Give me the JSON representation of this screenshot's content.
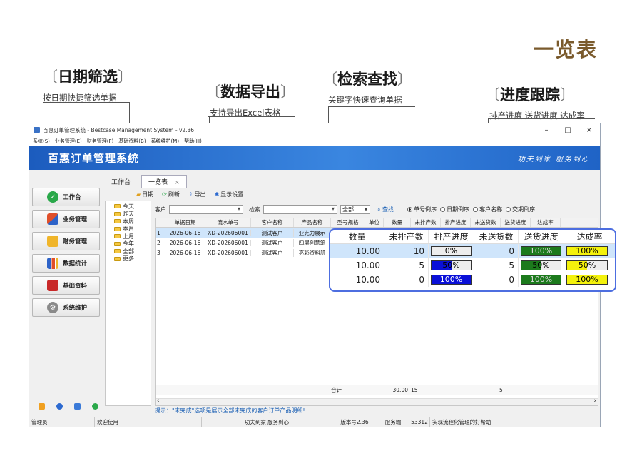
{
  "page_title": "一览表",
  "features": {
    "date_filter": {
      "title": "日期筛选",
      "desc": "按日期快捷筛选单据"
    },
    "data_export": {
      "title": "数据导出",
      "desc": "支持导出Excel表格"
    },
    "search": {
      "title": "检索查找",
      "desc": "关键字快速查询单据"
    },
    "progress": {
      "title": "进度跟踪",
      "desc": "排产进度 送货进度 达成率"
    }
  },
  "window": {
    "title": "百惠订单管理系统 - Bestcase Management System - v2.36",
    "controls": {
      "minimize": "–",
      "maximize": "□",
      "close": "×"
    },
    "menu": [
      "系统(S)",
      "业务管理(E)",
      "财务管理(F)",
      "基础资料(B)",
      "系统维护(M)",
      "帮助(H)"
    ],
    "banner_title": "百惠订单管理系统",
    "banner_slogan": "功夫到家 服务到心",
    "tabs": [
      {
        "label": "工作台"
      },
      {
        "label": "一览表",
        "close": "×"
      }
    ],
    "sidebar": [
      {
        "label": "工作台",
        "icon": "check-icon",
        "color": "#2aa84a"
      },
      {
        "label": "业务管理",
        "icon": "puzzle-icon",
        "color": "#e04f2a"
      },
      {
        "label": "财务管理",
        "icon": "folder-icon",
        "color": "#f0b52a"
      },
      {
        "label": "数据统计",
        "icon": "bar-chart-icon",
        "color": "#2d63c8"
      },
      {
        "label": "基础资料",
        "icon": "book-icon",
        "color": "#c82828"
      },
      {
        "label": "系统维护",
        "icon": "gear-icon",
        "color": "#8a8a8a"
      }
    ],
    "sidebar_bottom_icons": [
      {
        "icon": "note-icon",
        "color": "#f0a020"
      },
      {
        "icon": "info-icon",
        "color": "#2d6ad0"
      },
      {
        "icon": "calendar-icon",
        "color": "#3a7ad8"
      },
      {
        "icon": "refresh-icon",
        "color": "#2aa84a"
      }
    ],
    "toolbar": {
      "date": "日期",
      "refresh": "刷新",
      "export": "导出",
      "display_settings": "显示设置"
    },
    "tree": [
      "今天",
      "昨天",
      "本周",
      "本月",
      "上月",
      "今年",
      "全部",
      "更多.."
    ],
    "filter": {
      "customer_label": "客户",
      "search_label": "检索",
      "scope_value": "全部",
      "find_button": "查找..",
      "sort_options": [
        {
          "label": "单号倒序",
          "checked": true
        },
        {
          "label": "日期倒序",
          "checked": false
        },
        {
          "label": "客户名称",
          "checked": false
        },
        {
          "label": "交期倒序",
          "checked": false
        }
      ]
    },
    "grid": {
      "columns": [
        "",
        "单据日期",
        "流水单号",
        "客户名称",
        "产品名称",
        "型号规格",
        "单位",
        "数量",
        "未排产数",
        "排产进度",
        "未送货数",
        "送货进度",
        "达成率"
      ],
      "rows": [
        [
          "1",
          "2026-06-16",
          "XD-202606001",
          "测试客户",
          "亚克力展示"
        ],
        [
          "2",
          "2026-06-16",
          "XD-202606001",
          "测试客户",
          "四层创意笔"
        ],
        [
          "3",
          "2026-06-16",
          "XD-202606001",
          "测试客户",
          "亮彩资料册"
        ]
      ],
      "footer": {
        "total_label": "合计",
        "quantity": "30.00",
        "unscheduled": "15",
        "undelivered": "5"
      },
      "scroll_left": "‹",
      "scroll_right": "›"
    },
    "hint": "提示：\"未完成\"选项是展示全部未完成的客户订单产品明细!",
    "status": [
      "管理员",
      "欢迎使用",
      "功夫到家 服务到心",
      "版本号2.36",
      "服务端",
      "53312",
      "实现流程化管理的好帮助"
    ]
  },
  "zoom": {
    "columns": [
      "数量",
      "未排产数",
      "排产进度",
      "未送货数",
      "送货进度",
      "达成率"
    ],
    "rows": [
      {
        "quantity": "10.00",
        "unscheduled": "10",
        "schedule_progress": 0,
        "schedule_label": "0%",
        "undelivered": "0",
        "delivery_progress": 100,
        "delivery_label": "100%",
        "achievement": 100,
        "achievement_label": "100%"
      },
      {
        "quantity": "10.00",
        "unscheduled": "5",
        "schedule_progress": 50,
        "schedule_label": "50%",
        "undelivered": "5",
        "delivery_progress": 50,
        "delivery_label": "50%",
        "achievement": 50,
        "achievement_label": "50%"
      },
      {
        "quantity": "10.00",
        "unscheduled": "0",
        "schedule_progress": 100,
        "schedule_label": "100%",
        "undelivered": "0",
        "delivery_progress": 100,
        "delivery_label": "100%",
        "achievement": 100,
        "achievement_label": "100%"
      }
    ],
    "colors": {
      "schedule": "#0a10d8",
      "delivery": "#1c7a1c",
      "achievement": "#f4f20c"
    }
  }
}
